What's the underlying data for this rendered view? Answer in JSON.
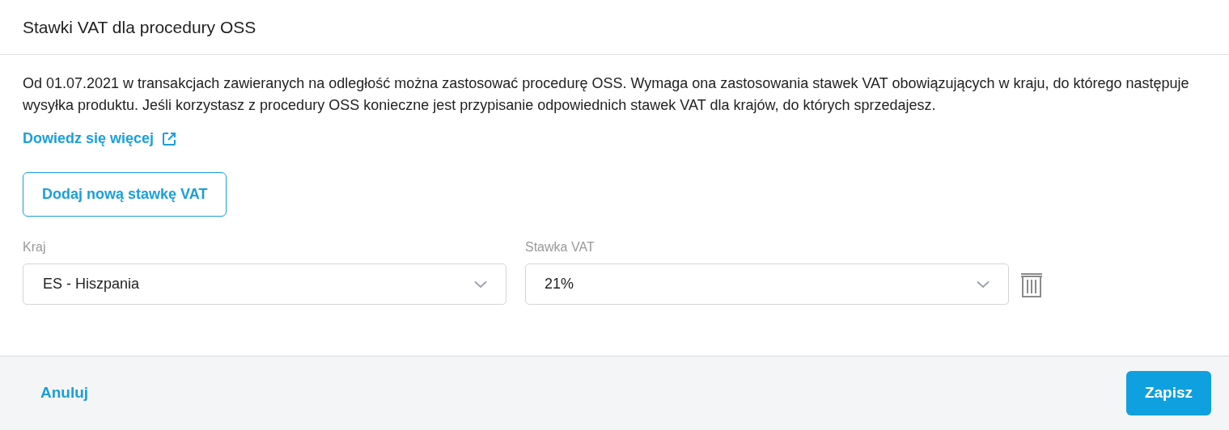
{
  "dialog": {
    "title": "Stawki VAT dla procedury OSS"
  },
  "description": "Od 01.07.2021 w transakcjach zawieranych na odległość można zastosować procedurę OSS. Wymaga ona zastosowania stawek VAT obowiązujących w kraju, do którego następuje wysyłka produktu. Jeśli korzystasz z procedury OSS konieczne jest przypisanie odpowiednich stawek VAT dla krajów, do których sprzedajesz.",
  "learn_more_link": "Dowiedz się więcej",
  "add_button": "Dodaj nową stawkę VAT",
  "columns": [
    "Kraj",
    "Stawka VAT"
  ],
  "rows": [
    {
      "country": "ES - Hiszpania",
      "rate": "21%"
    }
  ],
  "footer": {
    "cancel": "Anuluj",
    "save": "Zapisz"
  }
}
